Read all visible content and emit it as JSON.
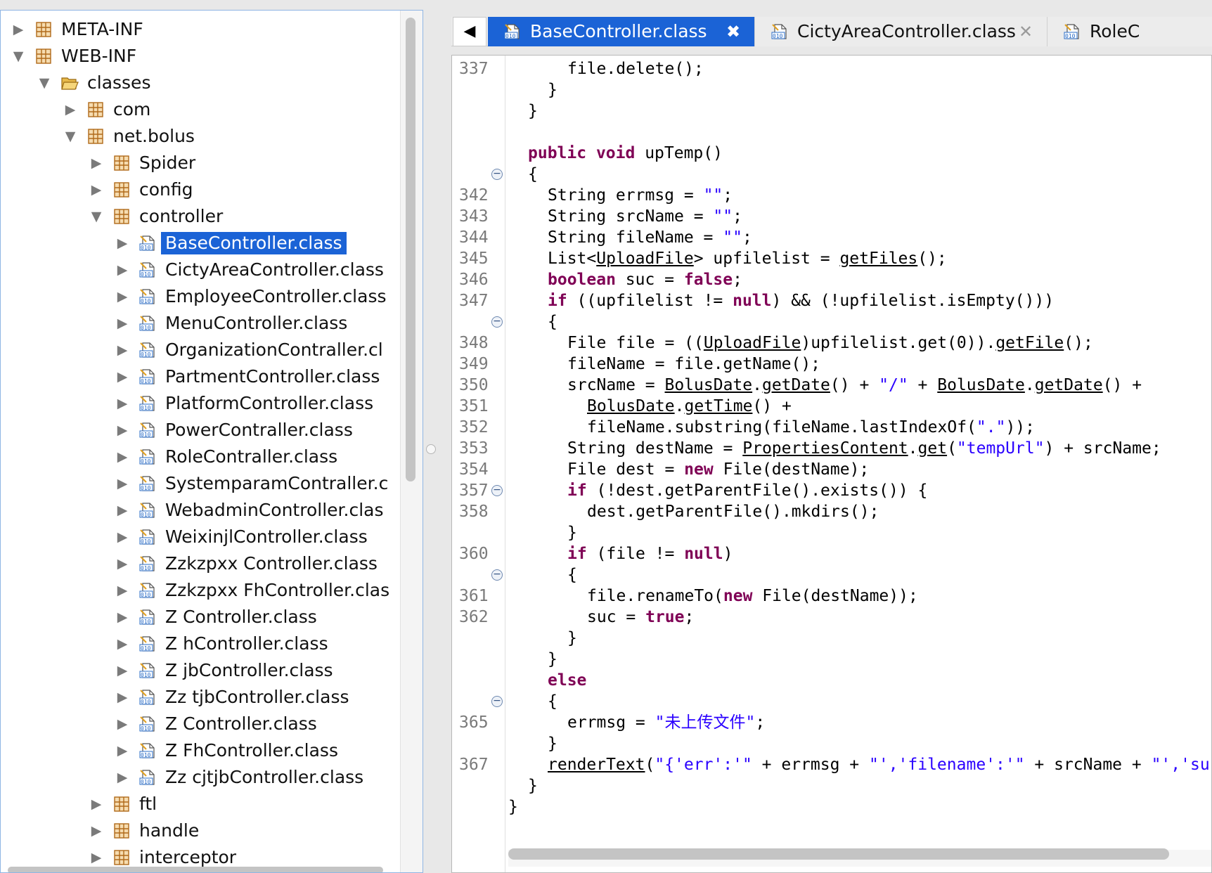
{
  "tree": {
    "rows": [
      {
        "label": "META-INF",
        "level": 0,
        "expanded": false,
        "icon": "package-icon"
      },
      {
        "label": "WEB-INF",
        "level": 0,
        "expanded": true,
        "icon": "package-icon"
      },
      {
        "label": "classes",
        "level": 1,
        "expanded": true,
        "icon": "folder-open-icon"
      },
      {
        "label": "com",
        "level": 2,
        "expanded": false,
        "icon": "package-icon"
      },
      {
        "label": "net.bolus",
        "level": 2,
        "expanded": true,
        "icon": "package-icon"
      },
      {
        "label": "Spider",
        "level": 3,
        "expanded": false,
        "icon": "package-icon"
      },
      {
        "label": "config",
        "level": 3,
        "expanded": false,
        "icon": "package-icon"
      },
      {
        "label": "controller",
        "level": 3,
        "expanded": true,
        "icon": "package-icon"
      },
      {
        "label": "BaseController.class",
        "level": 4,
        "expanded": false,
        "icon": "class-file-icon",
        "selected": true
      },
      {
        "label": "CictyAreaController.class",
        "level": 4,
        "expanded": false,
        "icon": "class-file-icon"
      },
      {
        "label": "EmployeeController.class",
        "level": 4,
        "expanded": false,
        "icon": "class-file-icon"
      },
      {
        "label": "MenuController.class",
        "level": 4,
        "expanded": false,
        "icon": "class-file-icon"
      },
      {
        "label": "OrganizationContraller.cl",
        "level": 4,
        "expanded": false,
        "icon": "class-file-icon"
      },
      {
        "label": "PartmentController.class",
        "level": 4,
        "expanded": false,
        "icon": "class-file-icon"
      },
      {
        "label": "PlatformController.class",
        "level": 4,
        "expanded": false,
        "icon": "class-file-icon"
      },
      {
        "label": "PowerContraller.class",
        "level": 4,
        "expanded": false,
        "icon": "class-file-icon"
      },
      {
        "label": "RoleContraller.class",
        "level": 4,
        "expanded": false,
        "icon": "class-file-icon"
      },
      {
        "label": "SystemparamContraller.c",
        "level": 4,
        "expanded": false,
        "icon": "class-file-icon"
      },
      {
        "label": "WebadminController.clas",
        "level": 4,
        "expanded": false,
        "icon": "class-file-icon"
      },
      {
        "label": "WeixinjlController.class",
        "level": 4,
        "expanded": false,
        "icon": "class-file-icon"
      },
      {
        "label": "Zzkzpxx Controller.class",
        "level": 4,
        "expanded": false,
        "icon": "class-file-icon"
      },
      {
        "label": "Zzkzpxx FhController.clas",
        "level": 4,
        "expanded": false,
        "icon": "class-file-icon"
      },
      {
        "label": "Z    Controller.class",
        "level": 4,
        "expanded": false,
        "icon": "class-file-icon"
      },
      {
        "label": "Z     hController.class",
        "level": 4,
        "expanded": false,
        "icon": "class-file-icon"
      },
      {
        "label": "Z     jbController.class",
        "level": 4,
        "expanded": false,
        "icon": "class-file-icon"
      },
      {
        "label": "Zz   tjbController.class",
        "level": 4,
        "expanded": false,
        "icon": "class-file-icon"
      },
      {
        "label": "Z    Controller.class",
        "level": 4,
        "expanded": false,
        "icon": "class-file-icon"
      },
      {
        "label": "Z   FhController.class",
        "level": 4,
        "expanded": false,
        "icon": "class-file-icon"
      },
      {
        "label": "Zz  cjtjbController.class",
        "level": 4,
        "expanded": false,
        "icon": "class-file-icon"
      },
      {
        "label": "ftl",
        "level": 3,
        "expanded": false,
        "icon": "package-icon"
      },
      {
        "label": "handle",
        "level": 3,
        "expanded": false,
        "icon": "package-icon"
      },
      {
        "label": "interceptor",
        "level": 3,
        "expanded": false,
        "icon": "package-icon"
      }
    ]
  },
  "tabs": {
    "nav_glyph": "◀",
    "items": [
      {
        "label": "BaseController.class",
        "active": true,
        "close_glyph": "✖"
      },
      {
        "label": "CictyAreaController.class",
        "active": false,
        "close_glyph": "✕"
      },
      {
        "label": "RoleC",
        "active": false,
        "close_glyph": ""
      }
    ]
  },
  "editor": {
    "lines": [
      {
        "no": "337",
        "indent": 3,
        "fold": false,
        "tokens": [
          [
            "p",
            "file.delete();"
          ]
        ]
      },
      {
        "no": "",
        "indent": 2,
        "fold": false,
        "tokens": [
          [
            "p",
            "}"
          ]
        ]
      },
      {
        "no": "",
        "indent": 1,
        "fold": false,
        "tokens": [
          [
            "p",
            "}"
          ]
        ]
      },
      {
        "no": "",
        "indent": 0,
        "fold": false,
        "tokens": []
      },
      {
        "no": "",
        "indent": 1,
        "fold": false,
        "tokens": [
          [
            "k",
            "public"
          ],
          [
            "p",
            " "
          ],
          [
            "k",
            "void"
          ],
          [
            "p",
            " upTemp()"
          ]
        ]
      },
      {
        "no": "",
        "indent": 1,
        "fold": true,
        "tokens": [
          [
            "p",
            "{"
          ]
        ]
      },
      {
        "no": "342",
        "indent": 2,
        "fold": false,
        "tokens": [
          [
            "p",
            "String errmsg = "
          ],
          [
            "s",
            "\"\""
          ],
          [
            "p",
            ";"
          ]
        ]
      },
      {
        "no": "343",
        "indent": 2,
        "fold": false,
        "tokens": [
          [
            "p",
            "String srcName = "
          ],
          [
            "s",
            "\"\""
          ],
          [
            "p",
            ";"
          ]
        ]
      },
      {
        "no": "344",
        "indent": 2,
        "fold": false,
        "tokens": [
          [
            "p",
            "String fileName = "
          ],
          [
            "s",
            "\"\""
          ],
          [
            "p",
            ";"
          ]
        ]
      },
      {
        "no": "345",
        "indent": 2,
        "fold": false,
        "tokens": [
          [
            "p",
            "List<"
          ],
          [
            "u",
            "UploadFile"
          ],
          [
            "p",
            "> upfilelist = "
          ],
          [
            "u",
            "getFiles"
          ],
          [
            "p",
            "();"
          ]
        ]
      },
      {
        "no": "346",
        "indent": 2,
        "fold": false,
        "tokens": [
          [
            "k",
            "boolean"
          ],
          [
            "p",
            " suc = "
          ],
          [
            "k",
            "false"
          ],
          [
            "p",
            ";"
          ]
        ]
      },
      {
        "no": "347",
        "indent": 2,
        "fold": false,
        "tokens": [
          [
            "k",
            "if"
          ],
          [
            "p",
            " ((upfilelist != "
          ],
          [
            "k",
            "null"
          ],
          [
            "p",
            ") && (!upfilelist.isEmpty()))"
          ]
        ]
      },
      {
        "no": "",
        "indent": 2,
        "fold": true,
        "tokens": [
          [
            "p",
            "{"
          ]
        ]
      },
      {
        "no": "348",
        "indent": 3,
        "fold": false,
        "tokens": [
          [
            "p",
            "File file = (("
          ],
          [
            "u",
            "UploadFile"
          ],
          [
            "p",
            ")upfilelist.get(0))."
          ],
          [
            "u",
            "getFile"
          ],
          [
            "p",
            "();"
          ]
        ]
      },
      {
        "no": "349",
        "indent": 3,
        "fold": false,
        "tokens": [
          [
            "p",
            "fileName = file.getName();"
          ]
        ]
      },
      {
        "no": "350",
        "indent": 3,
        "fold": false,
        "tokens": [
          [
            "p",
            "srcName = "
          ],
          [
            "u",
            "BolusDate"
          ],
          [
            "p",
            "."
          ],
          [
            "u",
            "getDate"
          ],
          [
            "p",
            "() + "
          ],
          [
            "s",
            "\"/\""
          ],
          [
            "p",
            " + "
          ],
          [
            "u",
            "BolusDate"
          ],
          [
            "p",
            "."
          ],
          [
            "u",
            "getDate"
          ],
          [
            "p",
            "() +"
          ]
        ]
      },
      {
        "no": "351",
        "indent": 4,
        "fold": false,
        "tokens": [
          [
            "u",
            "BolusDate"
          ],
          [
            "p",
            "."
          ],
          [
            "u",
            "getTime"
          ],
          [
            "p",
            "() +"
          ]
        ]
      },
      {
        "no": "352",
        "indent": 4,
        "fold": false,
        "tokens": [
          [
            "p",
            "fileName.substring(fileName.lastIndexOf("
          ],
          [
            "s",
            "\".\""
          ],
          [
            "p",
            "));"
          ]
        ]
      },
      {
        "no": "353",
        "indent": 3,
        "fold": false,
        "tokens": [
          [
            "p",
            "String destName = "
          ],
          [
            "u",
            "PropertiesContent"
          ],
          [
            "p",
            "."
          ],
          [
            "u",
            "get"
          ],
          [
            "p",
            "("
          ],
          [
            "s",
            "\"tempUrl\""
          ],
          [
            "p",
            ") + srcName;"
          ]
        ]
      },
      {
        "no": "354",
        "indent": 3,
        "fold": false,
        "tokens": [
          [
            "p",
            "File dest = "
          ],
          [
            "k",
            "new"
          ],
          [
            "p",
            " File(destName);"
          ]
        ]
      },
      {
        "no": "357",
        "indent": 3,
        "fold": true,
        "tokens": [
          [
            "k",
            "if"
          ],
          [
            "p",
            " (!dest.getParentFile().exists()) {"
          ]
        ]
      },
      {
        "no": "358",
        "indent": 4,
        "fold": false,
        "tokens": [
          [
            "p",
            "dest.getParentFile().mkdirs();"
          ]
        ]
      },
      {
        "no": "",
        "indent": 3,
        "fold": false,
        "tokens": [
          [
            "p",
            "}"
          ]
        ]
      },
      {
        "no": "360",
        "indent": 3,
        "fold": false,
        "tokens": [
          [
            "k",
            "if"
          ],
          [
            "p",
            " (file != "
          ],
          [
            "k",
            "null"
          ],
          [
            "p",
            ")"
          ]
        ]
      },
      {
        "no": "",
        "indent": 3,
        "fold": true,
        "tokens": [
          [
            "p",
            "{"
          ]
        ]
      },
      {
        "no": "361",
        "indent": 4,
        "fold": false,
        "tokens": [
          [
            "p",
            "file.renameTo("
          ],
          [
            "k",
            "new"
          ],
          [
            "p",
            " File(destName));"
          ]
        ]
      },
      {
        "no": "362",
        "indent": 4,
        "fold": false,
        "tokens": [
          [
            "p",
            "suc = "
          ],
          [
            "k",
            "true"
          ],
          [
            "p",
            ";"
          ]
        ]
      },
      {
        "no": "",
        "indent": 3,
        "fold": false,
        "tokens": [
          [
            "p",
            "}"
          ]
        ]
      },
      {
        "no": "",
        "indent": 2,
        "fold": false,
        "tokens": [
          [
            "p",
            "}"
          ]
        ]
      },
      {
        "no": "",
        "indent": 2,
        "fold": false,
        "tokens": [
          [
            "k",
            "else"
          ]
        ]
      },
      {
        "no": "",
        "indent": 2,
        "fold": true,
        "tokens": [
          [
            "p",
            "{"
          ]
        ]
      },
      {
        "no": "365",
        "indent": 3,
        "fold": false,
        "tokens": [
          [
            "p",
            "errmsg = "
          ],
          [
            "s",
            "\"未上传文件\""
          ],
          [
            "p",
            ";"
          ]
        ]
      },
      {
        "no": "",
        "indent": 2,
        "fold": false,
        "tokens": [
          [
            "p",
            "}"
          ]
        ]
      },
      {
        "no": "367",
        "indent": 2,
        "fold": false,
        "tokens": [
          [
            "u",
            "renderText"
          ],
          [
            "p",
            "("
          ],
          [
            "s",
            "\"{'err':'\""
          ],
          [
            "p",
            " + errmsg + "
          ],
          [
            "s",
            "\"','filename':'\""
          ],
          [
            "p",
            " + srcName + "
          ],
          [
            "s",
            "\"','su"
          ]
        ]
      },
      {
        "no": "",
        "indent": 1,
        "fold": false,
        "tokens": [
          [
            "p",
            "}"
          ]
        ]
      },
      {
        "no": "",
        "indent": 0,
        "fold": false,
        "tokens": [
          [
            "p",
            "}"
          ]
        ]
      }
    ]
  }
}
